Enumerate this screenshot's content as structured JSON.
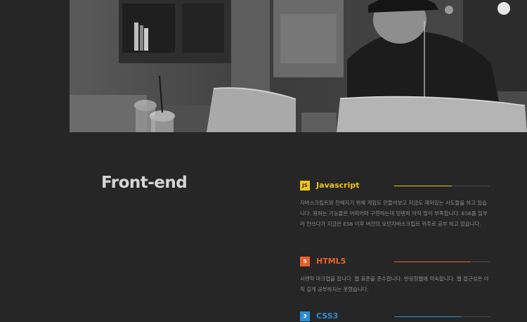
{
  "section": {
    "title": "Front-end"
  },
  "skills": [
    {
      "icon": "js-icon",
      "icon_text": "JS",
      "name": "Javascript",
      "level": 0.6,
      "color": "#f0c419",
      "description": "자바스크립트와 친해지기 위해 게임도 만들어보고 지금도 재미있는 시도들을 하고 있습니다. 원하는 기능들은 어떠어떠 구현하는데 텅텐히 아직 많이 부족합니다. ES6를 일부러 안쓰다가 지금은 ES6 이후 버전의 모던자바스크립트 위주로 공부 하고 있습니다."
    },
    {
      "icon": "html5-icon",
      "icon_text": "5",
      "name": "HTML5",
      "level": 0.8,
      "color": "#e8612a",
      "description": "시멘틱 마크업을 합니다. 웹 표준을 준수합니다. 반응형웹에 익숙합니다. 웹 접근성은 아직 깊게 공부하지는 못했습니다."
    },
    {
      "icon": "css3-icon",
      "icon_text": "3",
      "name": "CSS3",
      "level": 0.7,
      "color": "#2a8fd8",
      "description": ""
    }
  ]
}
